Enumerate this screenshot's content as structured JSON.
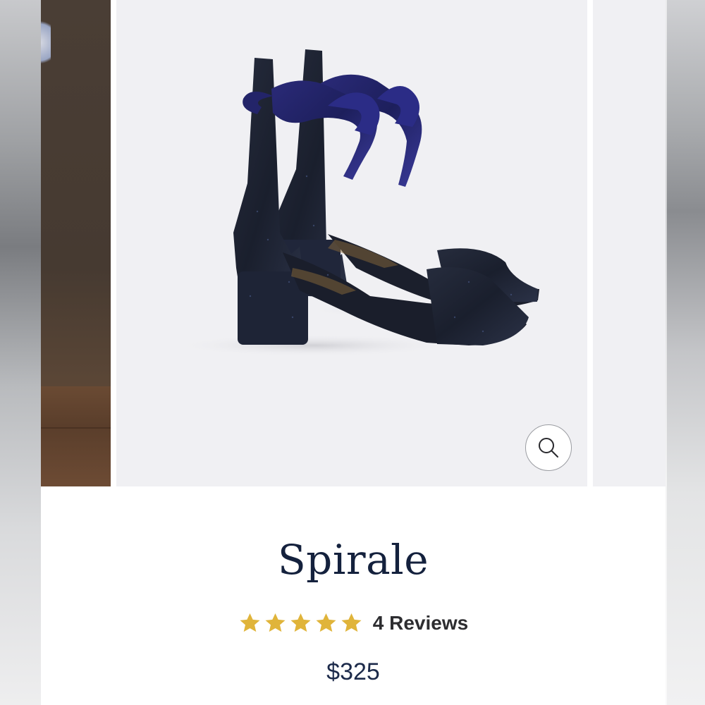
{
  "product": {
    "title": "Spirale",
    "rating": 5,
    "rating_max": 5,
    "reviews_label": "4 Reviews",
    "price": "$325"
  },
  "icons": {
    "zoom": "search-icon",
    "star": "star-icon"
  },
  "colors": {
    "title": "#14213d",
    "star": "#e0b43a",
    "price": "#1c2a4a"
  }
}
